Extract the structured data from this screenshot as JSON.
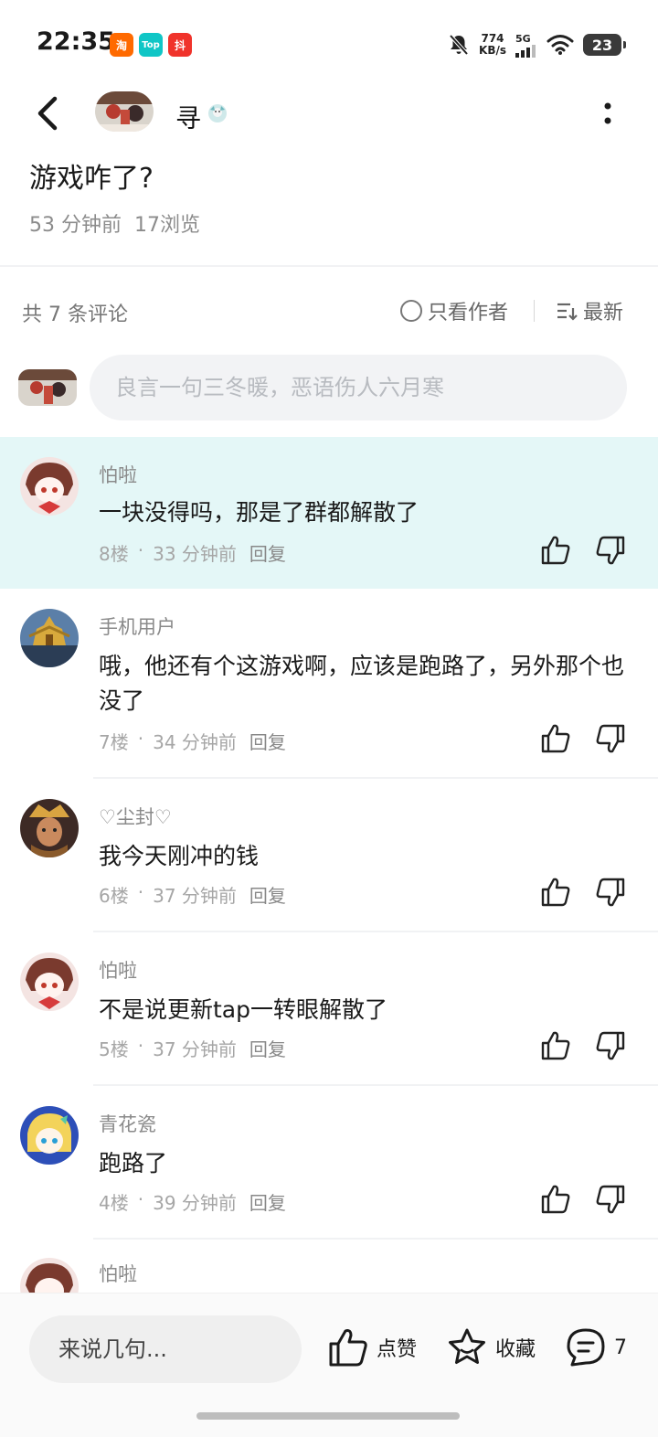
{
  "status_bar": {
    "time": "22:35",
    "app_badges": [
      "淘",
      "Top",
      "抖"
    ],
    "net_speed_value": "774",
    "net_speed_unit": "KB/s",
    "network": "5G",
    "battery": "23"
  },
  "header": {
    "author_name": "寻"
  },
  "post": {
    "title": "游戏咋了?",
    "time_ago": "53 分钟前",
    "views": "17浏览"
  },
  "comments_section": {
    "count_label": "共 7 条评论",
    "author_only_label": "只看作者",
    "sort_label": "最新",
    "composer_placeholder": "良言一句三冬暖，恶语伤人六月寒"
  },
  "comments": [
    {
      "name": "怕啦",
      "text": "一块没得吗，那是了群都解散了",
      "floor": "8楼",
      "time": "33 分钟前",
      "reply": "回复"
    },
    {
      "name": "手机用户",
      "text": "哦，他还有个这游戏啊，应该是跑路了，另外那个也没了",
      "floor": "7楼",
      "time": "34 分钟前",
      "reply": "回复"
    },
    {
      "name": "♡尘封♡",
      "text": "我今天刚冲的钱",
      "floor": "6楼",
      "time": "37 分钟前",
      "reply": "回复"
    },
    {
      "name": "怕啦",
      "text": "不是说更新tap一转眼解散了",
      "floor": "5楼",
      "time": "37 分钟前",
      "reply": "回复"
    },
    {
      "name": "青花瓷",
      "text": "跑路了",
      "floor": "4楼",
      "time": "39 分钟前",
      "reply": "回复"
    },
    {
      "name": "怕啦"
    }
  ],
  "bottom_bar": {
    "input_placeholder": "来说几句...",
    "like_label": "点赞",
    "favorite_label": "收藏",
    "comment_count": "7"
  },
  "colors": {
    "highlight_row": "#e4f7f7",
    "text_primary": "#1a1a1a",
    "text_secondary": "#8a8a8a"
  }
}
